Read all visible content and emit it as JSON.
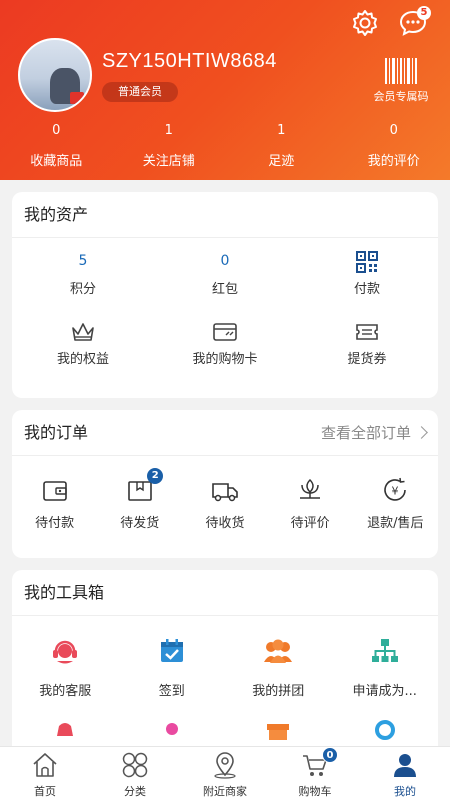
{
  "header": {
    "username": "SZY150HTIW8684",
    "level": "普通会员",
    "barcode_label": "会员专属码",
    "message_badge": "5"
  },
  "stats": [
    {
      "value": "0",
      "label": "收藏商品"
    },
    {
      "value": "1",
      "label": "关注店铺"
    },
    {
      "value": "1",
      "label": "足迹"
    },
    {
      "value": "0",
      "label": "我的评价"
    }
  ],
  "assets": {
    "title": "我的资产",
    "items": [
      {
        "value": "5",
        "label": "积分"
      },
      {
        "value": "0",
        "label": "红包"
      },
      {
        "icon": "qr-pay-icon",
        "label": "付款"
      },
      {
        "icon": "crown-icon",
        "label": "我的权益"
      },
      {
        "icon": "card-icon",
        "label": "我的购物卡"
      },
      {
        "icon": "voucher-icon",
        "label": "提货券"
      }
    ]
  },
  "orders": {
    "title": "我的订单",
    "view_all": "查看全部订单",
    "items": [
      {
        "icon": "wallet-icon",
        "label": "待付款"
      },
      {
        "icon": "package-icon",
        "label": "待发货",
        "badge": "2"
      },
      {
        "icon": "truck-icon",
        "label": "待收货"
      },
      {
        "icon": "flower-icon",
        "label": "待评价"
      },
      {
        "icon": "refund-icon",
        "label": "退款/售后"
      }
    ]
  },
  "tools": {
    "title": "我的工具箱",
    "items": [
      {
        "icon": "customer-service-icon",
        "label": "我的客服",
        "color": "#e94a5a"
      },
      {
        "icon": "calendar-check-icon",
        "label": "签到",
        "color": "#2d8fd6"
      },
      {
        "icon": "group-icon",
        "label": "我的拼团",
        "color": "#f07a2a"
      },
      {
        "icon": "org-chart-icon",
        "label": "申请成为...",
        "color": "#2fae9a"
      }
    ]
  },
  "tabbar": {
    "items": [
      {
        "icon": "home-icon",
        "label": "首页"
      },
      {
        "icon": "category-icon",
        "label": "分类"
      },
      {
        "icon": "location-icon",
        "label": "附近商家"
      },
      {
        "icon": "cart-icon",
        "label": "购物车",
        "badge": "0"
      },
      {
        "icon": "user-icon",
        "label": "我的",
        "active": true
      }
    ]
  },
  "colors": {
    "header_start": "#ec3a22",
    "header_end": "#f47a2a",
    "accent_blue": "#1a6ab8",
    "badge_blue": "#1a5fa8",
    "active_tab": "#1b4f8f"
  }
}
